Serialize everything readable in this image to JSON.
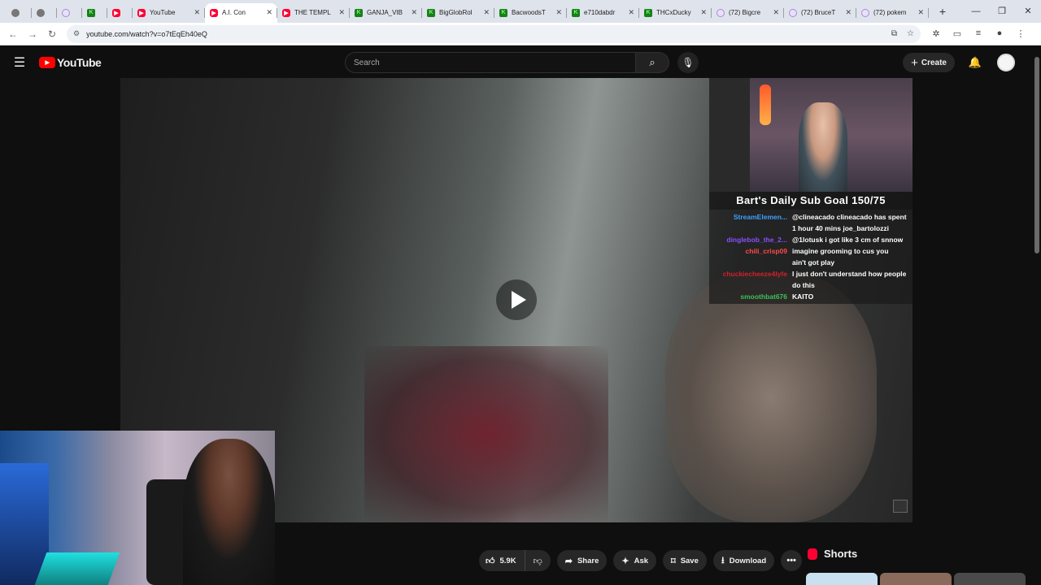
{
  "browser": {
    "tabs": [
      {
        "title": "",
        "favicon": "chrome-icon"
      },
      {
        "title": "",
        "favicon": "blank-icon"
      },
      {
        "title": "",
        "favicon": "twitch-icon"
      },
      {
        "title": "",
        "favicon": "kick-icon"
      },
      {
        "title": "",
        "favicon": "youtube-icon"
      },
      {
        "title": "YouTube",
        "favicon": "youtube-icon"
      },
      {
        "title": "A.I. Con",
        "favicon": "youtube-icon",
        "active": true
      },
      {
        "title": "THE TEMPL",
        "favicon": "youtube-icon"
      },
      {
        "title": "GANJA_VIB",
        "favicon": "kick-icon"
      },
      {
        "title": "BigGlobRol",
        "favicon": "kick-icon"
      },
      {
        "title": "BacwoodsT",
        "favicon": "kick-icon"
      },
      {
        "title": "e710dabdr",
        "favicon": "kick-icon"
      },
      {
        "title": "THCxDucky",
        "favicon": "kick-icon"
      },
      {
        "title": "(72) Bigcre",
        "favicon": "twitch-icon"
      },
      {
        "title": "(72) BruceT",
        "favicon": "twitch-icon"
      },
      {
        "title": "(72) pokem",
        "favicon": "twitch-icon"
      }
    ],
    "url": "youtube.com/watch?v=o7tEqEh40eQ"
  },
  "youtube": {
    "logo_text": "YouTube",
    "search_placeholder": "Search",
    "create_label": "Create"
  },
  "overlay": {
    "goal": "Bart's Daily Sub Goal 150/75",
    "chat": [
      {
        "name": "StreamElemen...",
        "color": "#3ea0ff",
        "msg": "@clineacado clineacado has spent"
      },
      {
        "name": "",
        "color": "#3ea0ff",
        "msg": "1 hour 40 mins  joe_bartolozzi"
      },
      {
        "name": "dinglebob_the_2...",
        "color": "#8a4fff",
        "msg": "@1lotusk i got like 3 cm of snnow"
      },
      {
        "name": "chili_crisp09",
        "color": "#ff4a4a",
        "msg": "imagine grooming to  cus you"
      },
      {
        "name": "",
        "color": "#ff4a4a",
        "msg": "ain't got  play"
      },
      {
        "name": "chuckiecheeze4lyfe",
        "color": "#d0202a",
        "msg": "I just don't understand how people"
      },
      {
        "name": "",
        "color": "#d0202a",
        "msg": "do this"
      },
      {
        "name": "smoothbat676",
        "color": "#3ec05a",
        "msg": "KAITO"
      }
    ]
  },
  "actions": {
    "like_count": "5.9K",
    "share": "Share",
    "ask": "Ask",
    "save": "Save",
    "download": "Download"
  },
  "shorts": {
    "title": "Shorts"
  }
}
